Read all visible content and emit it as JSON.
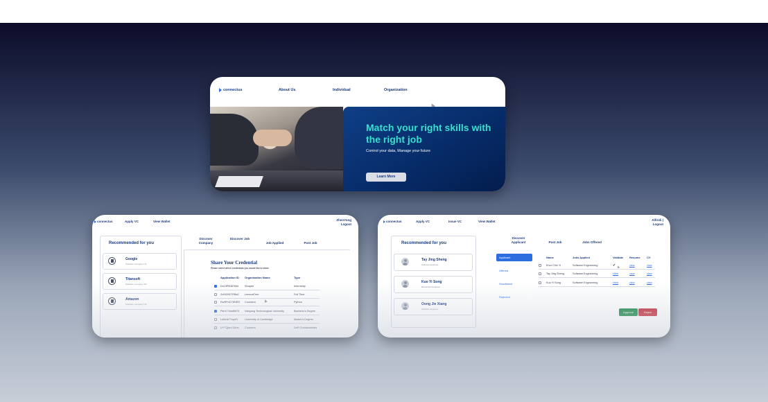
{
  "landing": {
    "logo": "connectus",
    "nav": [
      "About Us",
      "Individual",
      "Organization"
    ],
    "headline": "Match your right skills with the right job",
    "subtext": "Control your data, Manage your future",
    "cta": "Learn More"
  },
  "candidate": {
    "logo": "connectus",
    "nav": [
      "Apply VC",
      "View Wallet"
    ],
    "user_name": "ZhenYong",
    "logout": "Logout",
    "recommended_title": "Recommended for you",
    "recommended": [
      {
        "name": "Google",
        "sub": "Software Company US"
      },
      {
        "name": "Titansoft",
        "sub": "Software Company SG"
      },
      {
        "name": "Amazon",
        "sub": "Software Company US"
      }
    ],
    "tabs": [
      "Discover Company",
      "Discover Job",
      "Job Applied",
      "Post Job"
    ],
    "share_title": "Share Your Credential",
    "share_sub": "Please select which credentials you would like to share",
    "columns": [
      "Application ID",
      "Organisation Name",
      "Type"
    ],
    "rows": [
      {
        "checked": true,
        "id": "Dx13P5087654",
        "org": "Shopee",
        "type": "Internship"
      },
      {
        "checked": false,
        "id": "Zx09291TRBa2",
        "org": "LemmaTree",
        "type": "Full Time"
      },
      {
        "checked": false,
        "id": "RwRFdCY8NRS",
        "org": "Coursera",
        "type": "Python"
      },
      {
        "checked": true,
        "id": "PshX71idzB675",
        "org": "Nanyang Technological University",
        "type": "Bachelor's Degree"
      },
      {
        "checked": false,
        "id": "LaBzIk7YxqeR",
        "org": "University of Cambridge",
        "type": "Master's Degree"
      },
      {
        "checked": false,
        "id": "UYTQjzcv13rnn",
        "org": "Coursera",
        "type": "DeFi Fundamentals"
      }
    ]
  },
  "employer": {
    "logo": "connectus",
    "nav": [
      "Apply VC",
      "Issue VC",
      "View Wallet"
    ],
    "user_name": "Alfiridi |",
    "logout": "Logout",
    "recommended_title": "Recommended for you",
    "recommended": [
      {
        "name": "Tay Jing Sheng",
        "sub": "Software Engineer"
      },
      {
        "name": "Kuo Yi Song",
        "sub": "Blockchain Engineer"
      },
      {
        "name": "Oong Jie Xiang",
        "sub": "Software Engineer"
      }
    ],
    "tabs": [
      "Discover Applicant",
      "Post Job",
      "Jobs Offered"
    ],
    "status": [
      "Applicant",
      "Offered",
      "Shortlisted",
      "Rejected"
    ],
    "columns": [
      "Name",
      "Jobs Applied",
      "Validate",
      "Resume",
      "CV"
    ],
    "rows": [
      {
        "name": "Khor Chin Yi",
        "job": "Software Engineering",
        "validate": "✔",
        "resume": "view",
        "cv": "view"
      },
      {
        "name": "Tay Jing Sheng",
        "job": "Software Engineering",
        "validate": "Here",
        "resume": "view",
        "cv": "view"
      },
      {
        "name": "Kuo Yi Song",
        "job": "Software Engineering",
        "validate": "Here",
        "resume": "view",
        "cv": "view"
      }
    ],
    "approve": "Approve",
    "reject": "Reject"
  },
  "colors": {
    "accent": "#2c6de0",
    "hero_text": "#36e0cf",
    "hero_bg": "#062a66",
    "approve": "#1f8a4a",
    "reject": "#c62f3d"
  }
}
